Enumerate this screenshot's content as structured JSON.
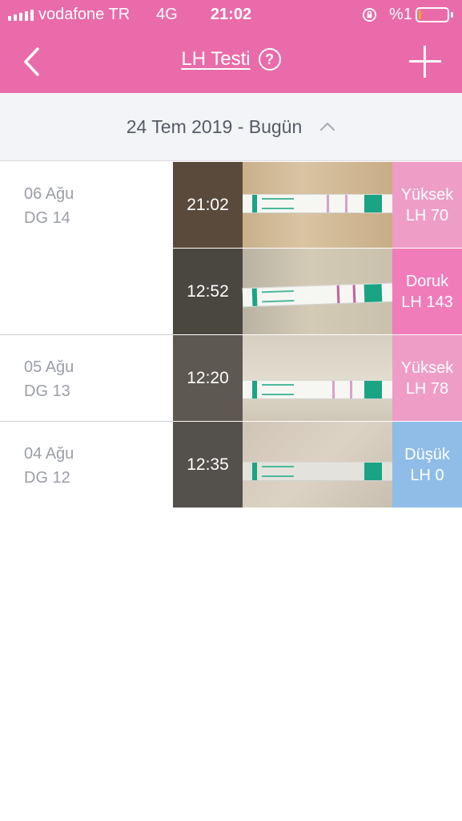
{
  "status_bar": {
    "carrier": "vodafone TR",
    "network": "4G",
    "time": "21:02",
    "battery": "%1",
    "icons": [
      "signal-icon",
      "rotation-lock-icon",
      "battery-icon"
    ]
  },
  "nav": {
    "title": "LH Testi",
    "help": "?",
    "icons": [
      "back-icon",
      "help-icon",
      "add-icon"
    ]
  },
  "range": {
    "label": "24 Tem 2019 - Bugün"
  },
  "colors": {
    "header": "#e96ba9",
    "high": "#ee9dc7",
    "peak": "#f07cba",
    "low": "#8fbde8"
  },
  "days": [
    {
      "date": "06 Ağu",
      "cycle_day": "DG 14",
      "tests": [
        {
          "time": "21:02",
          "level": "Yüksek",
          "value": "LH 70"
        },
        {
          "time": "12:52",
          "level": "Doruk",
          "value": "LH 143"
        }
      ]
    },
    {
      "date": "05 Ağu",
      "cycle_day": "DG 13",
      "tests": [
        {
          "time": "12:20",
          "level": "Yüksek",
          "value": "LH 78"
        }
      ]
    },
    {
      "date": "04 Ağu",
      "cycle_day": "DG 12",
      "tests": [
        {
          "time": "12:35",
          "level": "Düşük",
          "value": "LH 0"
        }
      ]
    }
  ]
}
